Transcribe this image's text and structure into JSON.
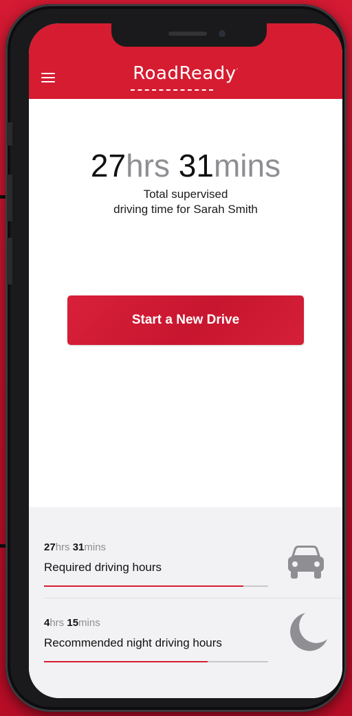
{
  "app": {
    "name": "RoadReady",
    "brand_color": "#d61c31"
  },
  "header": {
    "menu_icon": "hamburger-menu-icon",
    "logo_text": "RoadReady"
  },
  "summary": {
    "hours": "27",
    "hours_unit": "hrs",
    "minutes": "31",
    "minutes_unit": "mins",
    "caption_line1": "Total supervised",
    "caption_line2": "driving time for Sarah Smith"
  },
  "actions": {
    "start_drive_label": "Start a New Drive"
  },
  "stats": [
    {
      "hours": "27",
      "hours_unit": "hrs",
      "minutes": "31",
      "minutes_unit": "mins",
      "label": "Required driving hours",
      "progress": 0.89,
      "icon": "car-icon"
    },
    {
      "hours": "4",
      "hours_unit": "hrs",
      "minutes": "15",
      "minutes_unit": "mins",
      "label": "Recommended night driving hours",
      "progress": 0.73,
      "icon": "moon-icon"
    }
  ]
}
